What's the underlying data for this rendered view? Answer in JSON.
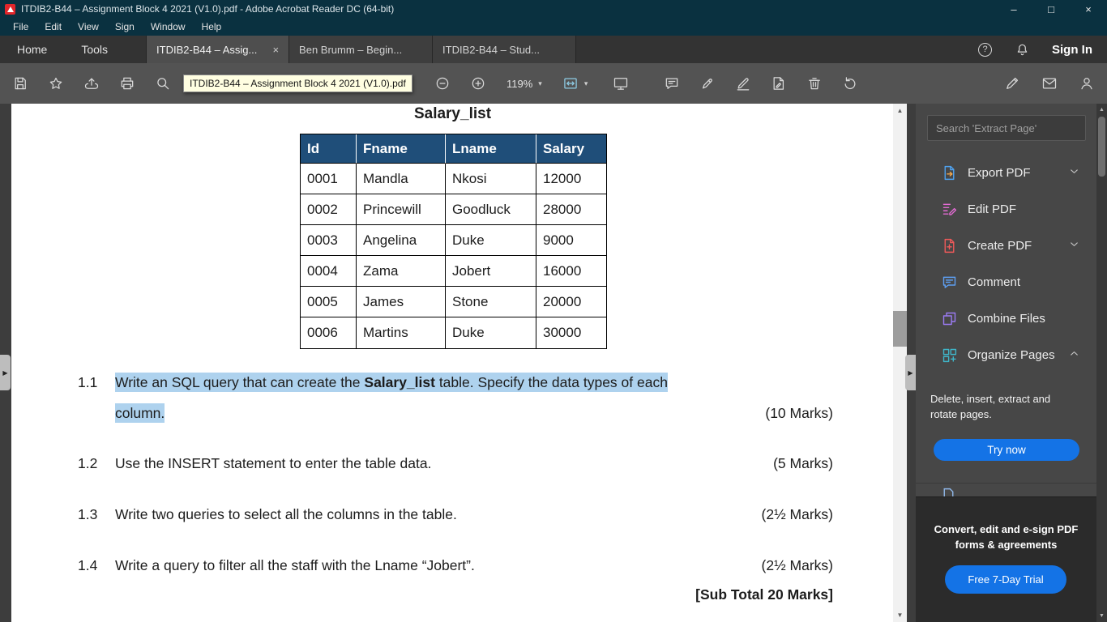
{
  "window": {
    "title": "ITDIB2-B44 – Assignment Block 4 2021 (V1.0).pdf - Adobe Acrobat Reader DC (64-bit)"
  },
  "glyphs": {
    "minimize": "–",
    "maximize": "□",
    "close": "×",
    "tab_close": "×",
    "help": "?",
    "caret": "▾",
    "pane_toggle": "▶",
    "scroll_up": "▲",
    "scroll_down": "▼"
  },
  "menu": {
    "items": [
      "File",
      "Edit",
      "View",
      "Sign",
      "Window",
      "Help"
    ]
  },
  "tabs": {
    "home": "Home",
    "tools": "Tools",
    "documents": [
      "ITDIB2-B44 – Assig...",
      "Ben Brumm – Begin...",
      "ITDIB2-B44 – Stud..."
    ],
    "sign_in": "Sign In"
  },
  "toolbar": {
    "zoom_level": "119%",
    "tooltip": "ITDIB2-B44 – Assignment Block 4 2021 (V1.0).pdf"
  },
  "document": {
    "table_title": "Salary_list",
    "table": {
      "headers": [
        "Id",
        "Fname",
        "Lname",
        "Salary"
      ],
      "rows": [
        [
          "0001",
          "Mandla",
          "Nkosi",
          "12000"
        ],
        [
          "0002",
          "Princewill",
          "Goodluck",
          "28000"
        ],
        [
          "0003",
          "Angelina",
          "Duke",
          "9000"
        ],
        [
          "0004",
          "Zama",
          "Jobert",
          "16000"
        ],
        [
          "0005",
          "James",
          "Stone",
          "20000"
        ],
        [
          "0006",
          "Martins",
          "Duke",
          "30000"
        ]
      ]
    },
    "questions": [
      {
        "number": "1.1",
        "pre": "Write an SQL query that can create the ",
        "bold": "Salary_list",
        "post": " table. Specify the data types of each",
        "line2": "column.",
        "marks": "(10 Marks)"
      },
      {
        "number": "1.2",
        "text": "Use the INSERT statement to enter the table data.",
        "marks": "(5 Marks)"
      },
      {
        "number": "1.3",
        "text": "Write two queries to select all the columns in the table.",
        "marks": "(2½ Marks)"
      },
      {
        "number": "1.4",
        "text": "Write a query to filter all the staff with the Lname “Jobert”.",
        "marks": "(2½ Marks)"
      }
    ],
    "subtotal": "[Sub Total 20 Marks]"
  },
  "sidebar": {
    "search_placeholder": "Search 'Extract Page'",
    "tools": [
      {
        "label": "Export PDF"
      },
      {
        "label": "Edit PDF"
      },
      {
        "label": "Create PDF"
      },
      {
        "label": "Comment"
      },
      {
        "label": "Combine Files"
      },
      {
        "label": "Organize Pages"
      }
    ],
    "organize_description": "Delete, insert, extract and rotate pages.",
    "try_now_label": "Try now",
    "promo_line1": "Convert, edit and e-sign PDF",
    "promo_line2": "forms & agreements",
    "promo_cta": "Free 7-Day Trial"
  }
}
